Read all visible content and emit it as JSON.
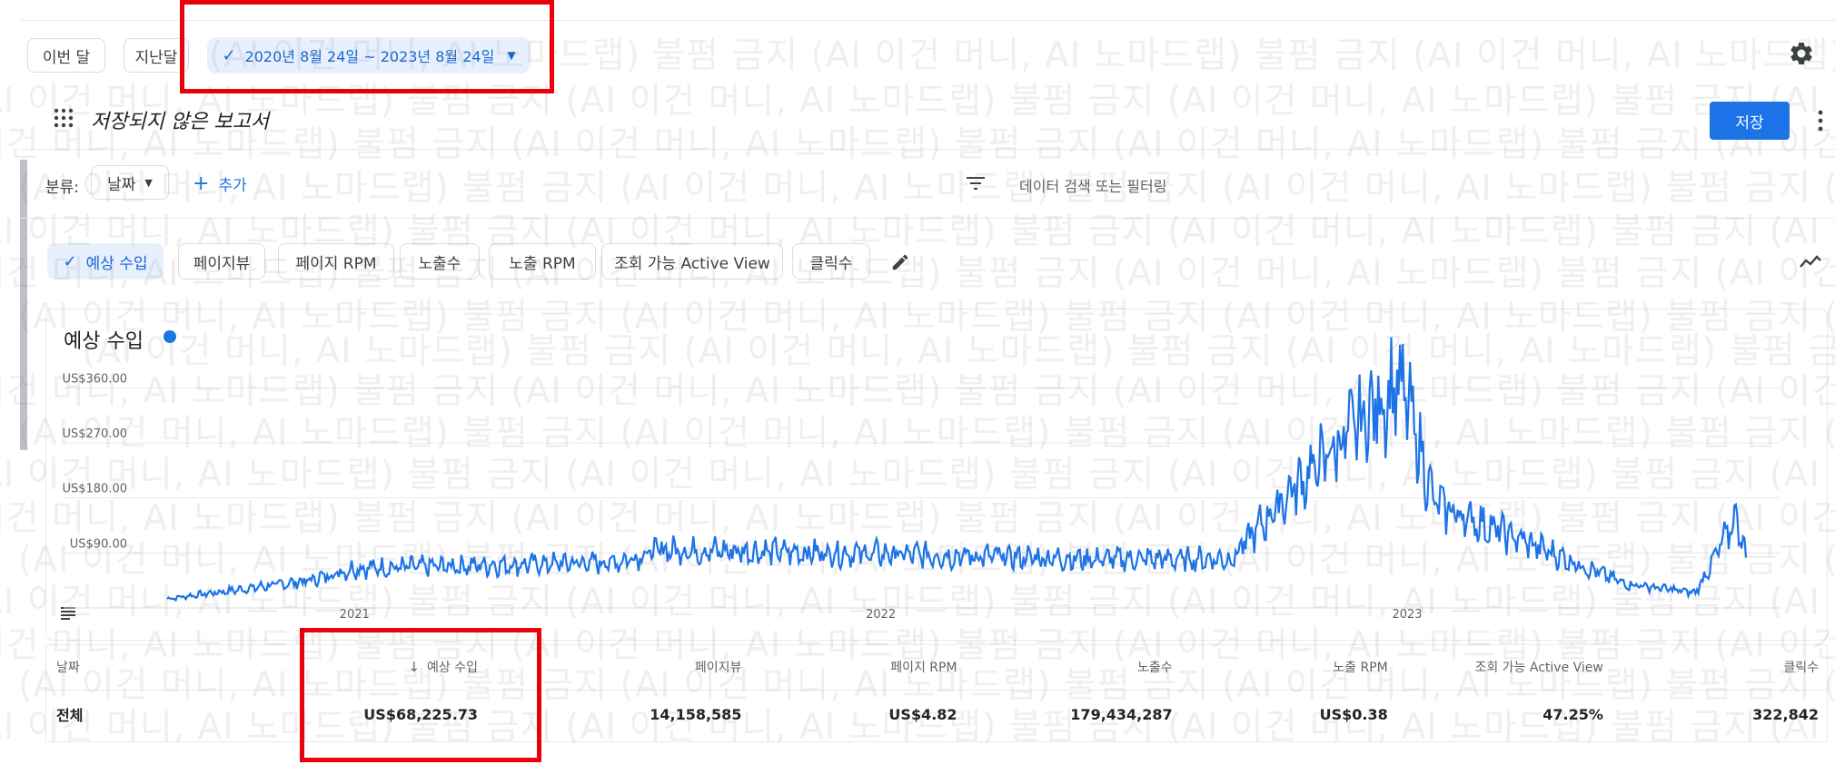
{
  "toolbar": {
    "this_month": "이번 달",
    "last_month": "지난달",
    "date_range": "2020년 8월 24일 ~ 2023년 8월 24일"
  },
  "report": {
    "title": "저장되지 않은 보고서",
    "save_label": "저장"
  },
  "breakdown": {
    "label": "분류:",
    "selected": "날짜",
    "add_label": "추가",
    "filter_placeholder": "데이터 검색 또는 필터링"
  },
  "metrics": [
    {
      "label": "예상 수입",
      "selected": true
    },
    {
      "label": "페이지뷰",
      "selected": false
    },
    {
      "label": "페이지 RPM",
      "selected": false
    },
    {
      "label": "노출수",
      "selected": false
    },
    {
      "label": "노출 RPM",
      "selected": false
    },
    {
      "label": "조회 가능 Active View",
      "selected": false
    },
    {
      "label": "클릭수",
      "selected": false
    }
  ],
  "chart_data": {
    "type": "line",
    "title": "예상 수입",
    "series": [
      {
        "name": "예상 수입",
        "color": "#1a73e8"
      }
    ],
    "yticks": [
      "US$360.00",
      "US$270.00",
      "US$180.00",
      "US$90.00"
    ],
    "ytick_values": [
      360,
      270,
      180,
      90
    ],
    "ylim": [
      0,
      380
    ],
    "xticks": [
      "2021",
      "2022",
      "2023"
    ],
    "xrange": [
      "2020-08-24",
      "2023-08-24"
    ],
    "key_points": [
      {
        "x": "2020-08-24",
        "y": 15
      },
      {
        "x": "2020-12-01",
        "y": 45
      },
      {
        "x": "2021-01-01",
        "y": 65
      },
      {
        "x": "2021-04-01",
        "y": 70
      },
      {
        "x": "2021-07-01",
        "y": 75
      },
      {
        "x": "2021-08-01",
        "y": 95
      },
      {
        "x": "2021-12-01",
        "y": 90
      },
      {
        "x": "2022-03-01",
        "y": 85
      },
      {
        "x": "2022-06-01",
        "y": 80
      },
      {
        "x": "2022-09-01",
        "y": 80
      },
      {
        "x": "2022-10-10",
        "y": 185
      },
      {
        "x": "2022-12-28",
        "y": 370
      },
      {
        "x": "2023-01-20",
        "y": 170
      },
      {
        "x": "2023-06-01",
        "y": 40
      },
      {
        "x": "2023-07-20",
        "y": 25
      },
      {
        "x": "2023-08-18",
        "y": 150
      },
      {
        "x": "2023-08-24",
        "y": 80
      }
    ]
  },
  "table": {
    "headers": [
      "날짜",
      "예상 수입",
      "페이지뷰",
      "페이지 RPM",
      "노출수",
      "노출 RPM",
      "조회 가능 Active View",
      "클릭수"
    ],
    "total_row": [
      "전체",
      "US$68,225.73",
      "14,158,585",
      "US$4.82",
      "179,434,287",
      "US$0.38",
      "47.25%",
      "322,842"
    ]
  },
  "watermark_text": "(AI 이건 머니, AI 노마드랩) 불펌 금지 ",
  "colors": {
    "accent": "#1a73e8",
    "highlight": "#e8000d"
  }
}
